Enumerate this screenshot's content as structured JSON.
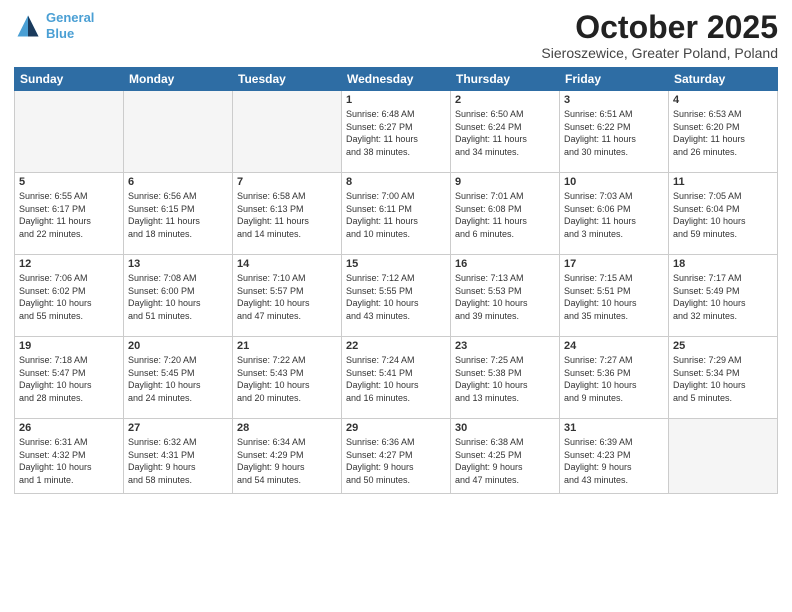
{
  "header": {
    "logo_line1": "General",
    "logo_line2": "Blue",
    "month": "October 2025",
    "location": "Sieroszewice, Greater Poland, Poland"
  },
  "days_of_week": [
    "Sunday",
    "Monday",
    "Tuesday",
    "Wednesday",
    "Thursday",
    "Friday",
    "Saturday"
  ],
  "weeks": [
    [
      {
        "day": "",
        "info": ""
      },
      {
        "day": "",
        "info": ""
      },
      {
        "day": "",
        "info": ""
      },
      {
        "day": "1",
        "info": "Sunrise: 6:48 AM\nSunset: 6:27 PM\nDaylight: 11 hours\nand 38 minutes."
      },
      {
        "day": "2",
        "info": "Sunrise: 6:50 AM\nSunset: 6:24 PM\nDaylight: 11 hours\nand 34 minutes."
      },
      {
        "day": "3",
        "info": "Sunrise: 6:51 AM\nSunset: 6:22 PM\nDaylight: 11 hours\nand 30 minutes."
      },
      {
        "day": "4",
        "info": "Sunrise: 6:53 AM\nSunset: 6:20 PM\nDaylight: 11 hours\nand 26 minutes."
      }
    ],
    [
      {
        "day": "5",
        "info": "Sunrise: 6:55 AM\nSunset: 6:17 PM\nDaylight: 11 hours\nand 22 minutes."
      },
      {
        "day": "6",
        "info": "Sunrise: 6:56 AM\nSunset: 6:15 PM\nDaylight: 11 hours\nand 18 minutes."
      },
      {
        "day": "7",
        "info": "Sunrise: 6:58 AM\nSunset: 6:13 PM\nDaylight: 11 hours\nand 14 minutes."
      },
      {
        "day": "8",
        "info": "Sunrise: 7:00 AM\nSunset: 6:11 PM\nDaylight: 11 hours\nand 10 minutes."
      },
      {
        "day": "9",
        "info": "Sunrise: 7:01 AM\nSunset: 6:08 PM\nDaylight: 11 hours\nand 6 minutes."
      },
      {
        "day": "10",
        "info": "Sunrise: 7:03 AM\nSunset: 6:06 PM\nDaylight: 11 hours\nand 3 minutes."
      },
      {
        "day": "11",
        "info": "Sunrise: 7:05 AM\nSunset: 6:04 PM\nDaylight: 10 hours\nand 59 minutes."
      }
    ],
    [
      {
        "day": "12",
        "info": "Sunrise: 7:06 AM\nSunset: 6:02 PM\nDaylight: 10 hours\nand 55 minutes."
      },
      {
        "day": "13",
        "info": "Sunrise: 7:08 AM\nSunset: 6:00 PM\nDaylight: 10 hours\nand 51 minutes."
      },
      {
        "day": "14",
        "info": "Sunrise: 7:10 AM\nSunset: 5:57 PM\nDaylight: 10 hours\nand 47 minutes."
      },
      {
        "day": "15",
        "info": "Sunrise: 7:12 AM\nSunset: 5:55 PM\nDaylight: 10 hours\nand 43 minutes."
      },
      {
        "day": "16",
        "info": "Sunrise: 7:13 AM\nSunset: 5:53 PM\nDaylight: 10 hours\nand 39 minutes."
      },
      {
        "day": "17",
        "info": "Sunrise: 7:15 AM\nSunset: 5:51 PM\nDaylight: 10 hours\nand 35 minutes."
      },
      {
        "day": "18",
        "info": "Sunrise: 7:17 AM\nSunset: 5:49 PM\nDaylight: 10 hours\nand 32 minutes."
      }
    ],
    [
      {
        "day": "19",
        "info": "Sunrise: 7:18 AM\nSunset: 5:47 PM\nDaylight: 10 hours\nand 28 minutes."
      },
      {
        "day": "20",
        "info": "Sunrise: 7:20 AM\nSunset: 5:45 PM\nDaylight: 10 hours\nand 24 minutes."
      },
      {
        "day": "21",
        "info": "Sunrise: 7:22 AM\nSunset: 5:43 PM\nDaylight: 10 hours\nand 20 minutes."
      },
      {
        "day": "22",
        "info": "Sunrise: 7:24 AM\nSunset: 5:41 PM\nDaylight: 10 hours\nand 16 minutes."
      },
      {
        "day": "23",
        "info": "Sunrise: 7:25 AM\nSunset: 5:38 PM\nDaylight: 10 hours\nand 13 minutes."
      },
      {
        "day": "24",
        "info": "Sunrise: 7:27 AM\nSunset: 5:36 PM\nDaylight: 10 hours\nand 9 minutes."
      },
      {
        "day": "25",
        "info": "Sunrise: 7:29 AM\nSunset: 5:34 PM\nDaylight: 10 hours\nand 5 minutes."
      }
    ],
    [
      {
        "day": "26",
        "info": "Sunrise: 6:31 AM\nSunset: 4:32 PM\nDaylight: 10 hours\nand 1 minute."
      },
      {
        "day": "27",
        "info": "Sunrise: 6:32 AM\nSunset: 4:31 PM\nDaylight: 9 hours\nand 58 minutes."
      },
      {
        "day": "28",
        "info": "Sunrise: 6:34 AM\nSunset: 4:29 PM\nDaylight: 9 hours\nand 54 minutes."
      },
      {
        "day": "29",
        "info": "Sunrise: 6:36 AM\nSunset: 4:27 PM\nDaylight: 9 hours\nand 50 minutes."
      },
      {
        "day": "30",
        "info": "Sunrise: 6:38 AM\nSunset: 4:25 PM\nDaylight: 9 hours\nand 47 minutes."
      },
      {
        "day": "31",
        "info": "Sunrise: 6:39 AM\nSunset: 4:23 PM\nDaylight: 9 hours\nand 43 minutes."
      },
      {
        "day": "",
        "info": ""
      }
    ]
  ]
}
